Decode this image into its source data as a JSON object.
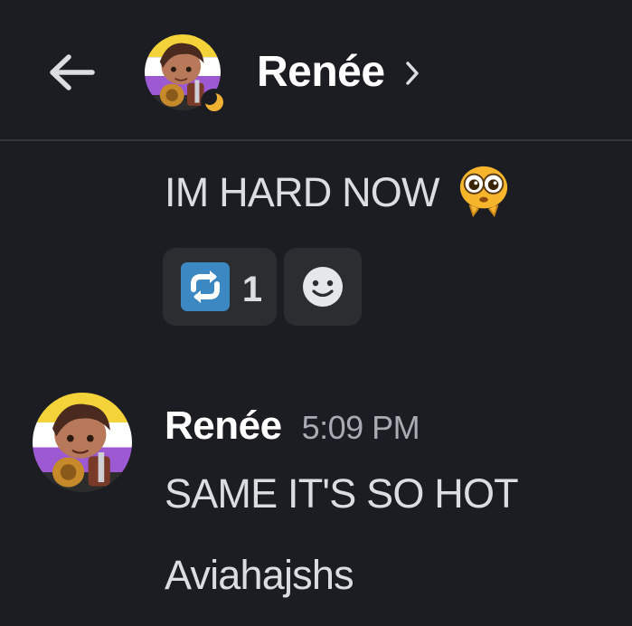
{
  "header": {
    "back_icon": "arrow-left-icon",
    "avatar_alt": "Renée",
    "title": "Renée",
    "status_icon": "moon-idle-icon",
    "chevron_icon": "chevron-right-icon"
  },
  "messages": [
    {
      "text": "IM HARD NOW",
      "emoji": "pleading-face-emoji",
      "reactions": [
        {
          "icon": "repeat-emoji",
          "count": "1"
        },
        {
          "icon": "add-reaction-icon"
        }
      ]
    },
    {
      "author": "Renée",
      "timestamp": "5:09 PM",
      "lines": [
        "SAME IT'S SO HOT",
        "Aviahajshs"
      ]
    }
  ],
  "colors": {
    "background": "#1c1d22",
    "text": "#dbdee1",
    "muted": "#a7abb3",
    "reaction_bg": "#2b2d31",
    "idle": "#f0b232",
    "repeat_blue": "#3b88c3"
  }
}
